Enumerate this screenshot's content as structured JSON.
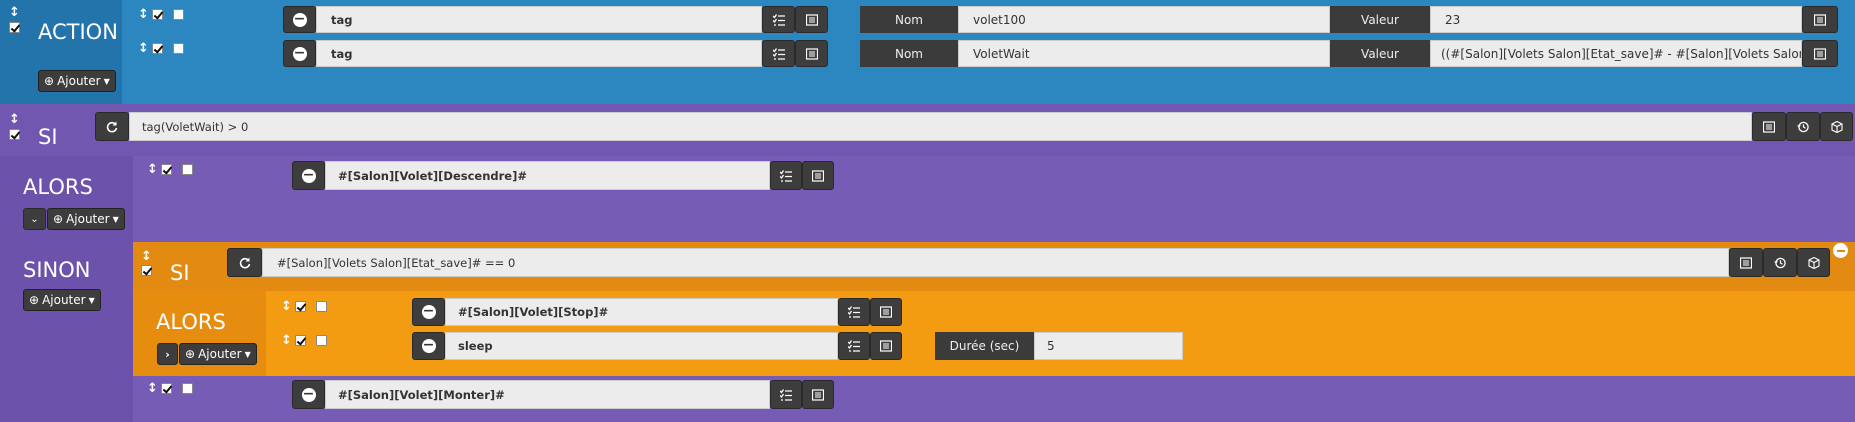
{
  "action_block": {
    "title": "ACTION",
    "add_label": "Ajouter",
    "rows": [
      {
        "type_value": "tag",
        "name_label": "Nom",
        "name_value": "volet100",
        "value_label": "Valeur",
        "value_value": "23"
      },
      {
        "type_value": "tag",
        "name_label": "Nom",
        "name_value": "VoletWait",
        "value_label": "Valeur",
        "value_value": "((#[Salon][Volets Salon][Etat_save]# - #[Salon][Volets Salon][Eta"
      }
    ]
  },
  "si_block": {
    "title": "SI",
    "condition": "tag(VoletWait) > 0",
    "alors_title": "ALORS",
    "alors_add_label": "Ajouter",
    "alors_command": "#[Salon][Volet][Descendre]#",
    "sinon_title": "SINON",
    "sinon_add_label": "Ajouter",
    "sinon_command": "#[Salon][Volet][Monter]#"
  },
  "nested_si_block": {
    "title": "SI",
    "condition": "#[Salon][Volets Salon][Etat_save]# == 0",
    "alors_title": "ALORS",
    "alors_add_label": "Ajouter",
    "commands": [
      {
        "value": "#[Salon][Volet][Stop]#"
      },
      {
        "value": "sleep",
        "duration_label": "Durée (sec)",
        "duration_value": "5"
      }
    ]
  },
  "colors": {
    "action_blue": "#2a83bd",
    "si_purple": "#7b5db4",
    "nested_orange": "#e38a12",
    "nested_alors_orange": "#f39c12",
    "button_dark": "#3d3d3d"
  }
}
